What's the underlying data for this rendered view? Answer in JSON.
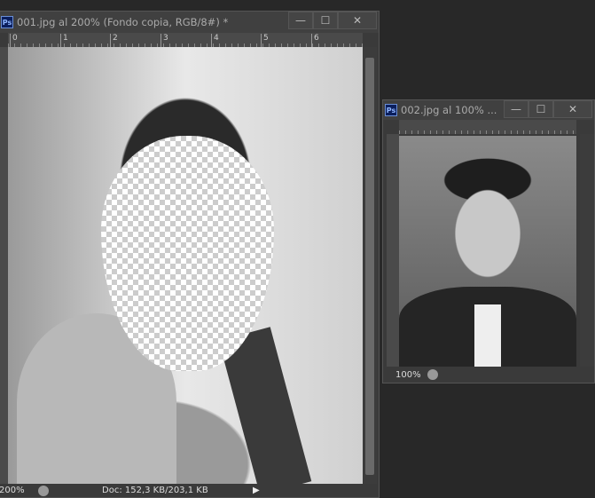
{
  "window1": {
    "title": "001.jpg al 200% (Fondo copia, RGB/8#) *",
    "ruler_ticks": [
      "0",
      "1",
      "2",
      "3",
      "4",
      "5",
      "6"
    ],
    "zoom": "200%",
    "doc_info": "Doc: 152,3 KB/203,1 KB",
    "app_badge": "Ps"
  },
  "window2": {
    "title": "002.jpg al 100% ...",
    "zoom": "100%",
    "app_badge": "Ps"
  },
  "controls": {
    "minimize": "—",
    "maximize": "☐",
    "close": "✕"
  }
}
